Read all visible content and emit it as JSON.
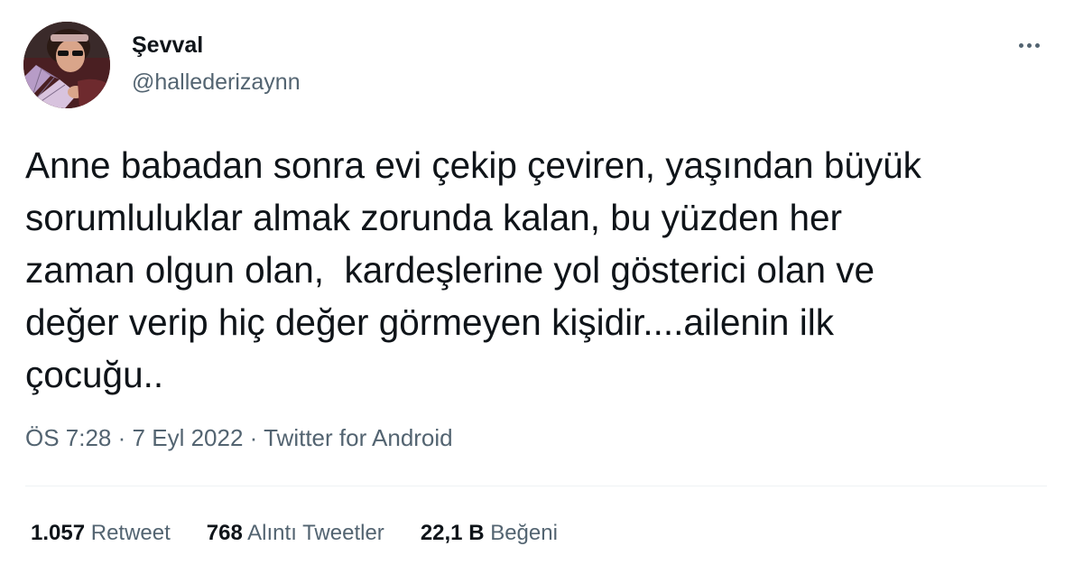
{
  "tweet": {
    "author": {
      "display_name": "Şevval",
      "handle": "@hallederizaynn"
    },
    "text": "Anne babadan sonra evi çekip çeviren, yaşından büyük\nsorumluluklar almak zorunda kalan, bu yüzden her\nzaman olgun olan,  kardeşlerine yol gösterici olan ve\ndeğer verip hiç değer görmeyen kişidir....ailenin ilk\nçocuğu..",
    "time": "ÖS 7:28",
    "separator": "·",
    "date": "7 Eyl 2022",
    "source": "Twitter for Android",
    "stats": [
      {
        "count": "1.057",
        "label": "Retweet"
      },
      {
        "count": "768",
        "label": "Alıntı Tweetler"
      },
      {
        "count": "22,1 B",
        "label": "Beğeni"
      }
    ]
  },
  "icons": {
    "more": "more-horizontal-icon"
  },
  "colors": {
    "text_primary": "#0f1419",
    "text_secondary": "#536471",
    "divider": "#eff3f4"
  }
}
